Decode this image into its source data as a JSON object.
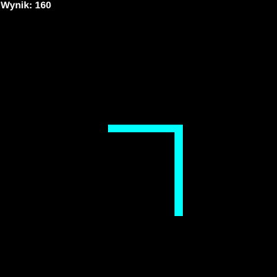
{
  "hud": {
    "score_text": "Wynik: 160"
  },
  "colors": {
    "background": "#000000",
    "snake": "#00ffff",
    "text": "#ffffff"
  }
}
